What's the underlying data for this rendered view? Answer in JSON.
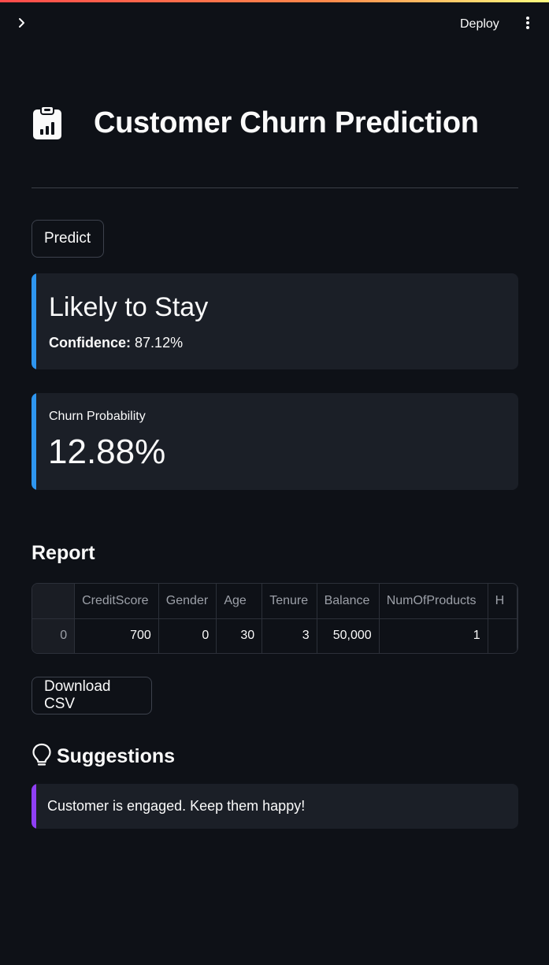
{
  "header": {
    "deploy_label": "Deploy",
    "accent_colors": [
      "#ff4b4b",
      "#fffd80"
    ]
  },
  "page": {
    "title": "Customer Churn Prediction",
    "title_icon": "clipboard-chart-icon"
  },
  "actions": {
    "predict_label": "Predict",
    "download_label": "Download CSV"
  },
  "result": {
    "headline": "Likely to Stay",
    "confidence_label": "Confidence:",
    "confidence_value": "87.12%",
    "accent_color": "#2e96f0"
  },
  "metric": {
    "label": "Churn Probability",
    "value": "12.88%"
  },
  "report": {
    "heading": "Report",
    "columns": [
      "",
      "CreditScore",
      "Gender",
      "Age",
      "Tenure",
      "Balance",
      "NumOfProducts",
      "H"
    ],
    "rows": [
      [
        "0",
        "700",
        "0",
        "30",
        "3",
        "50,000",
        "1",
        ""
      ]
    ]
  },
  "suggestions": {
    "heading": "Suggestions",
    "icon": "lightbulb-icon",
    "items": [
      "Customer is engaged. Keep them happy!"
    ],
    "accent_color": "#8f3ff5"
  }
}
